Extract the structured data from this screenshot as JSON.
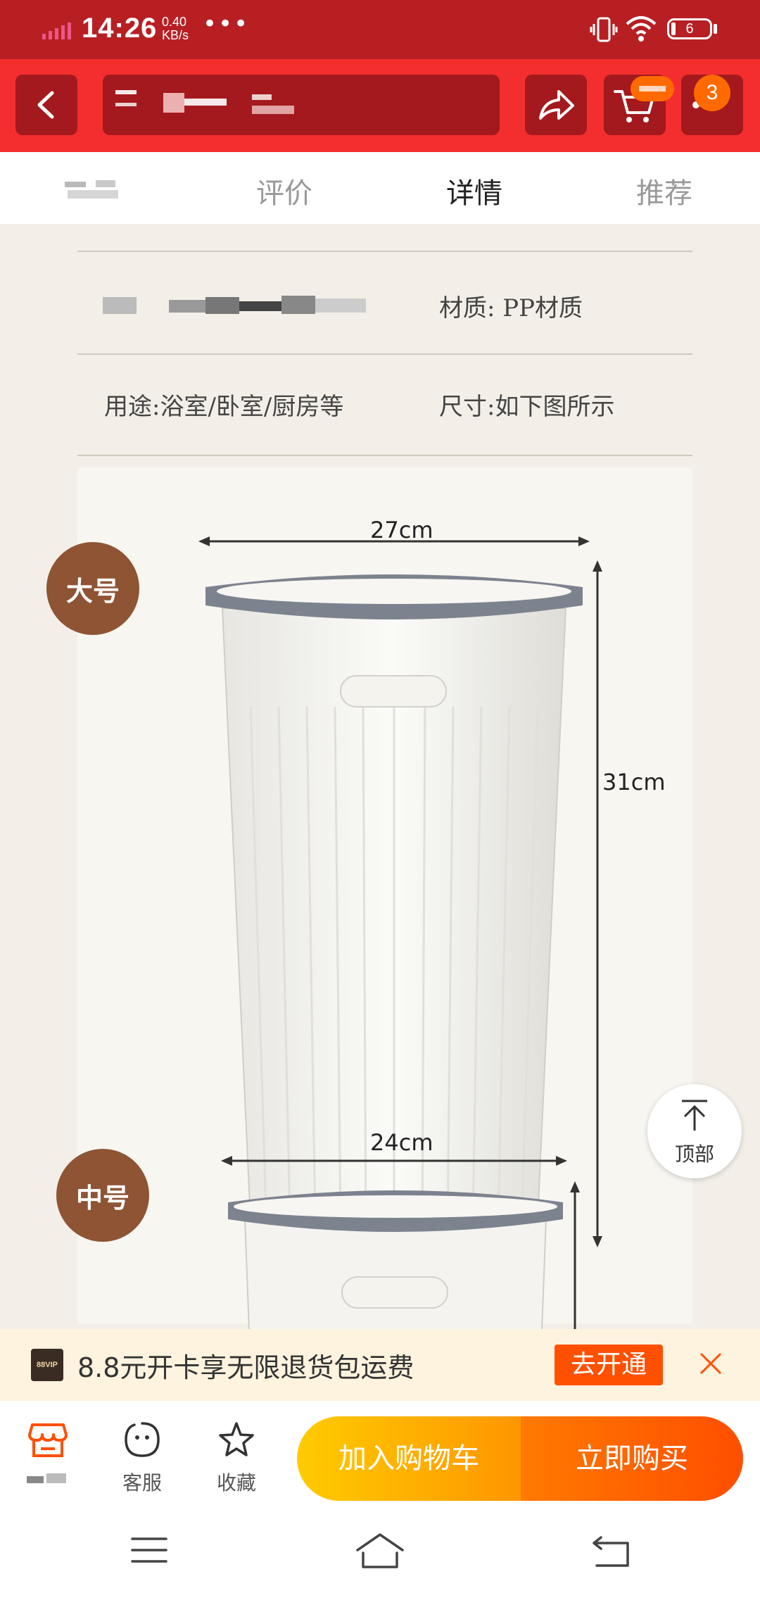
{
  "status_bar": {
    "time": "14:26",
    "speed_value": "0.40",
    "speed_unit": "KB/s",
    "more": "•••",
    "battery": "6"
  },
  "header": {
    "cart_badge": "3"
  },
  "tabs": [
    {
      "label": "评价"
    },
    {
      "label": "详情"
    },
    {
      "label": "推荐"
    }
  ],
  "specs": {
    "material": "材质: PP材质",
    "usage": "用途:浴室/卧室/厨房等",
    "size": "尺寸:如下图所示"
  },
  "products": {
    "large": {
      "badge": "大号",
      "width": "27cm",
      "height": "31cm"
    },
    "medium": {
      "badge": "中号",
      "width": "24cm"
    }
  },
  "float_top": {
    "label": "顶部"
  },
  "vip_bar": {
    "logo": "88VIP",
    "text": "8.8元开卡享无限退货包运费",
    "button": "去开通"
  },
  "action_bar": {
    "service": "客服",
    "favorite": "收藏",
    "add_to_cart": "加入购物车",
    "buy_now": "立即购买"
  }
}
